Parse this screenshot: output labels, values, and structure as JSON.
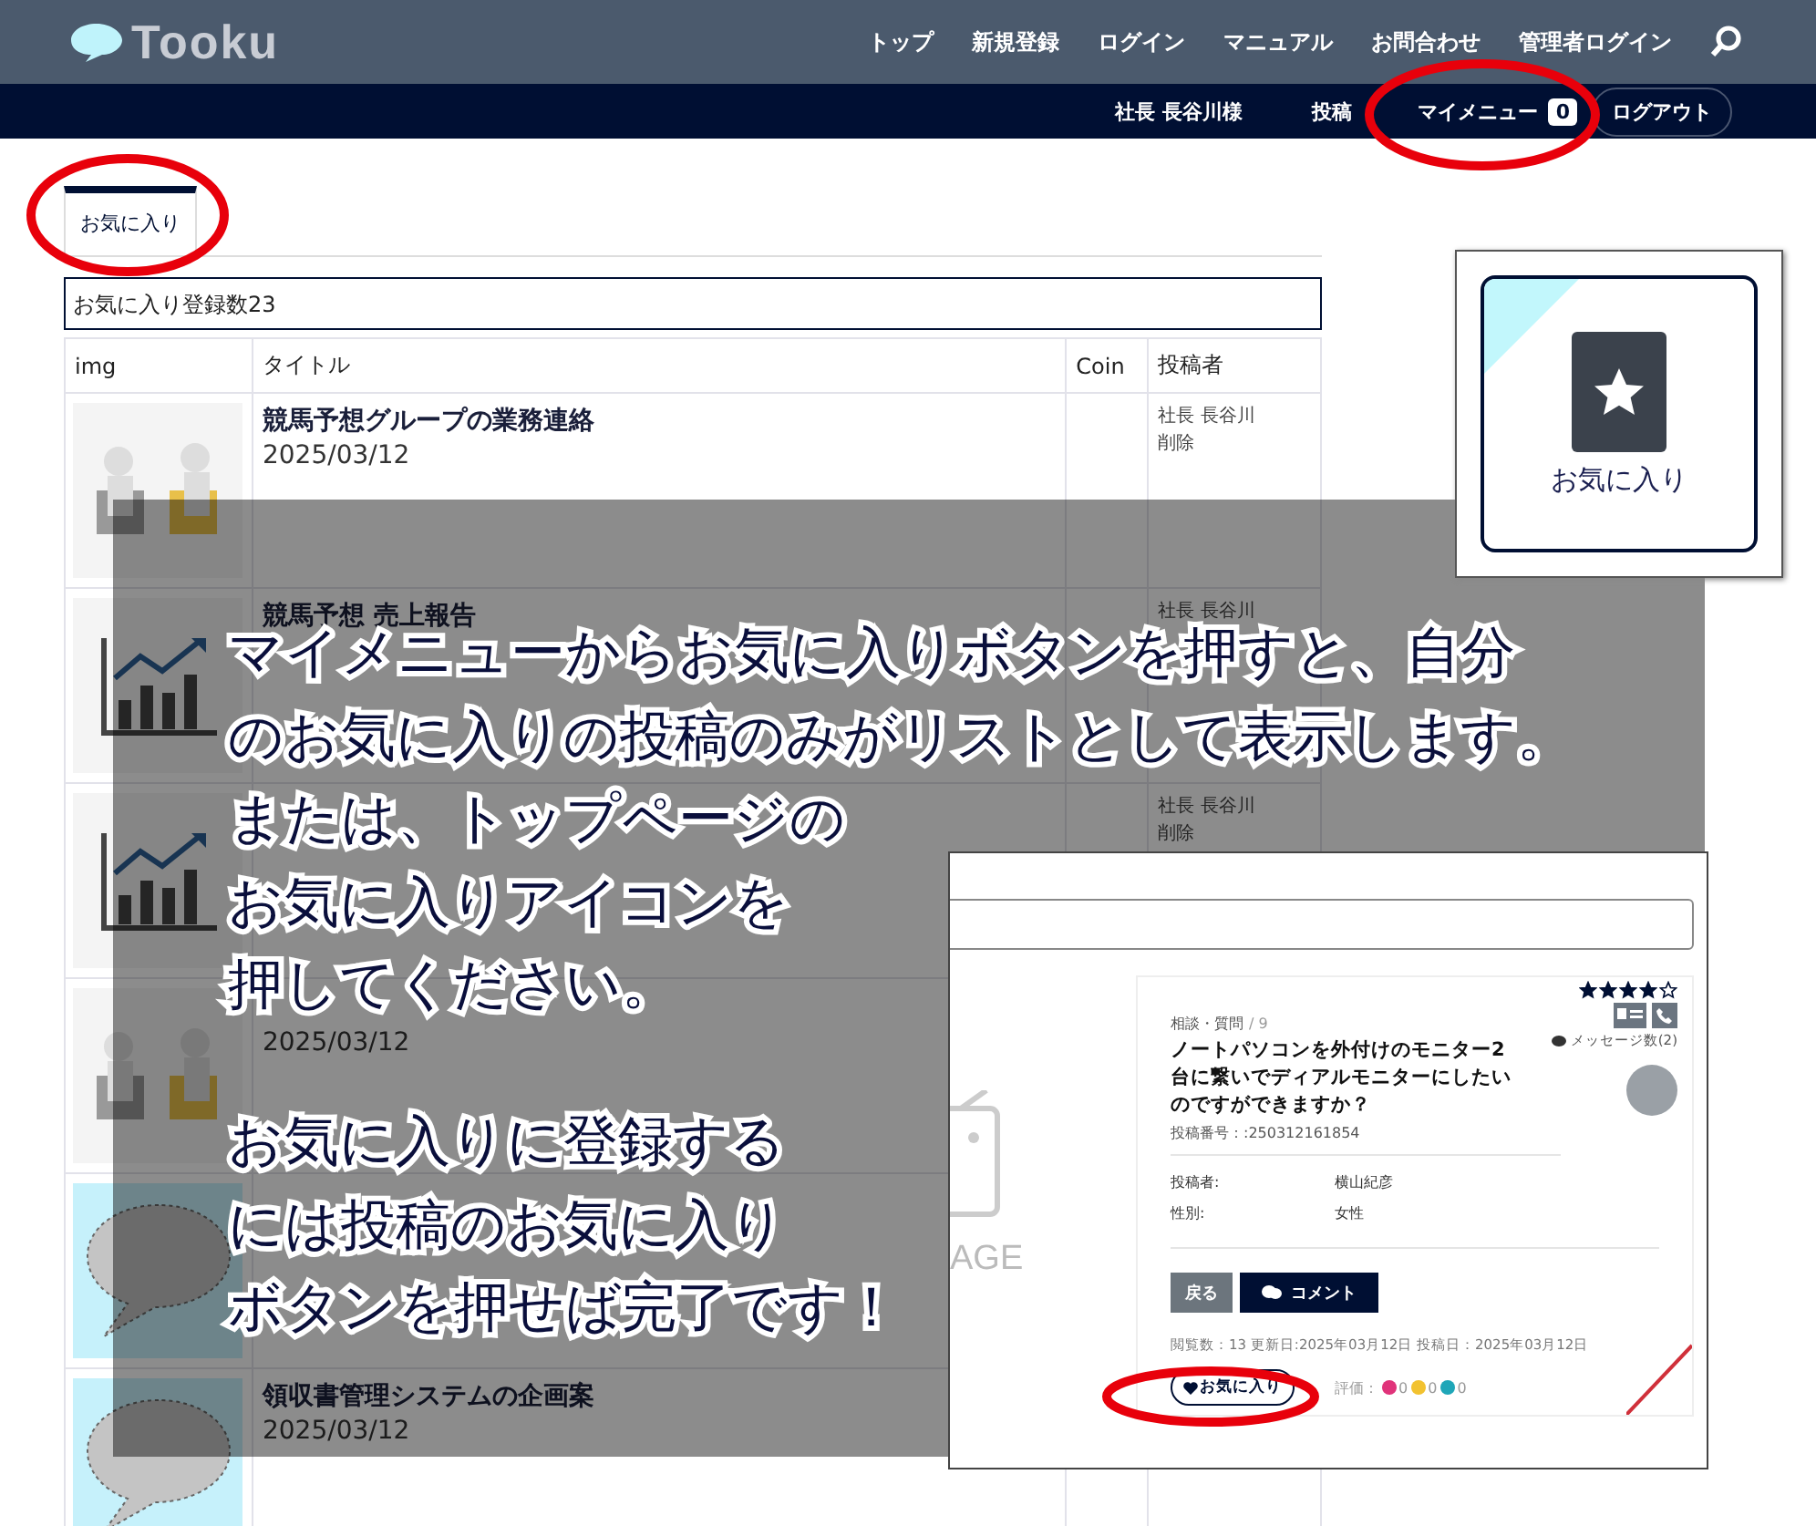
{
  "header": {
    "logo": "Tooku",
    "nav": [
      "トップ",
      "新規登録",
      "ログイン",
      "マニュアル",
      "お問合わせ",
      "管理者ログイン"
    ]
  },
  "subnav": {
    "user": "社長 長谷川様",
    "post": "投稿",
    "mymenu": "マイメニュー",
    "badge": "0",
    "logout": "ログアウト"
  },
  "tabs": [
    {
      "label": "お気に入り",
      "selected": true
    }
  ],
  "count": "お気に入り登録数23",
  "table": {
    "columns": [
      "img",
      "タイトル",
      "Coin",
      "投稿者"
    ],
    "rows": [
      {
        "kind": "people",
        "title": "競馬予想グループの業務連絡",
        "date": "2025/03/12",
        "author": "社長 長谷川",
        "action": "削除"
      },
      {
        "kind": "chart",
        "title": "競馬予想 売上報告",
        "author": "社長 長谷川"
      },
      {
        "kind": "chart",
        "author": "社長 長谷川",
        "action": "削除"
      },
      {
        "kind": "people",
        "date": "2025/03/12"
      },
      {
        "kind": "bubble"
      },
      {
        "kind": "bubble",
        "title": "領収書管理システムの企画案",
        "date": "2025/03/12"
      }
    ]
  },
  "favorite_tile": {
    "label": "お気に入り"
  },
  "overlay": {
    "paragraphs": [
      [
        "マイメニューからお気に入りボタンを押すと、自分",
        "のお気に入りの投稿のみがリストとして表示します。",
        "または、トップページの",
        "お気に入りアイコンを",
        "押してください。"
      ],
      [
        "お気に入りに登録する",
        "には投稿のお気に入り",
        "ボタンを押せば完了です！"
      ]
    ]
  },
  "inset": {
    "no_image": "AGE",
    "card": {
      "stars": 4,
      "category": "相談・質問",
      "number": "/ 9",
      "title": "ノートパソコンを外付けのモニター2台に繋いでディアルモニターにしたいのですができますか？",
      "messages": "メッセージ数(2)",
      "post_id": "投稿番号：:250312161854",
      "fields": [
        {
          "label": "投稿者:",
          "value": "横山紀彦"
        },
        {
          "label": "性別:",
          "value": "女性"
        }
      ],
      "buttons": [
        {
          "label": "戻る",
          "kind": "back"
        },
        {
          "label": "コメント",
          "kind": "comment"
        }
      ],
      "meta": "閲覧数：13 更新日:2025年03月12日 投稿日：2025年03月12日",
      "favorite": "お気に入り",
      "rating_label": "評価：",
      "ratings": [
        {
          "color": "#e0337a",
          "count": "0"
        },
        {
          "color": "#f2c230",
          "count": "0"
        },
        {
          "color": "#1fa6b8",
          "count": "0"
        }
      ]
    }
  }
}
